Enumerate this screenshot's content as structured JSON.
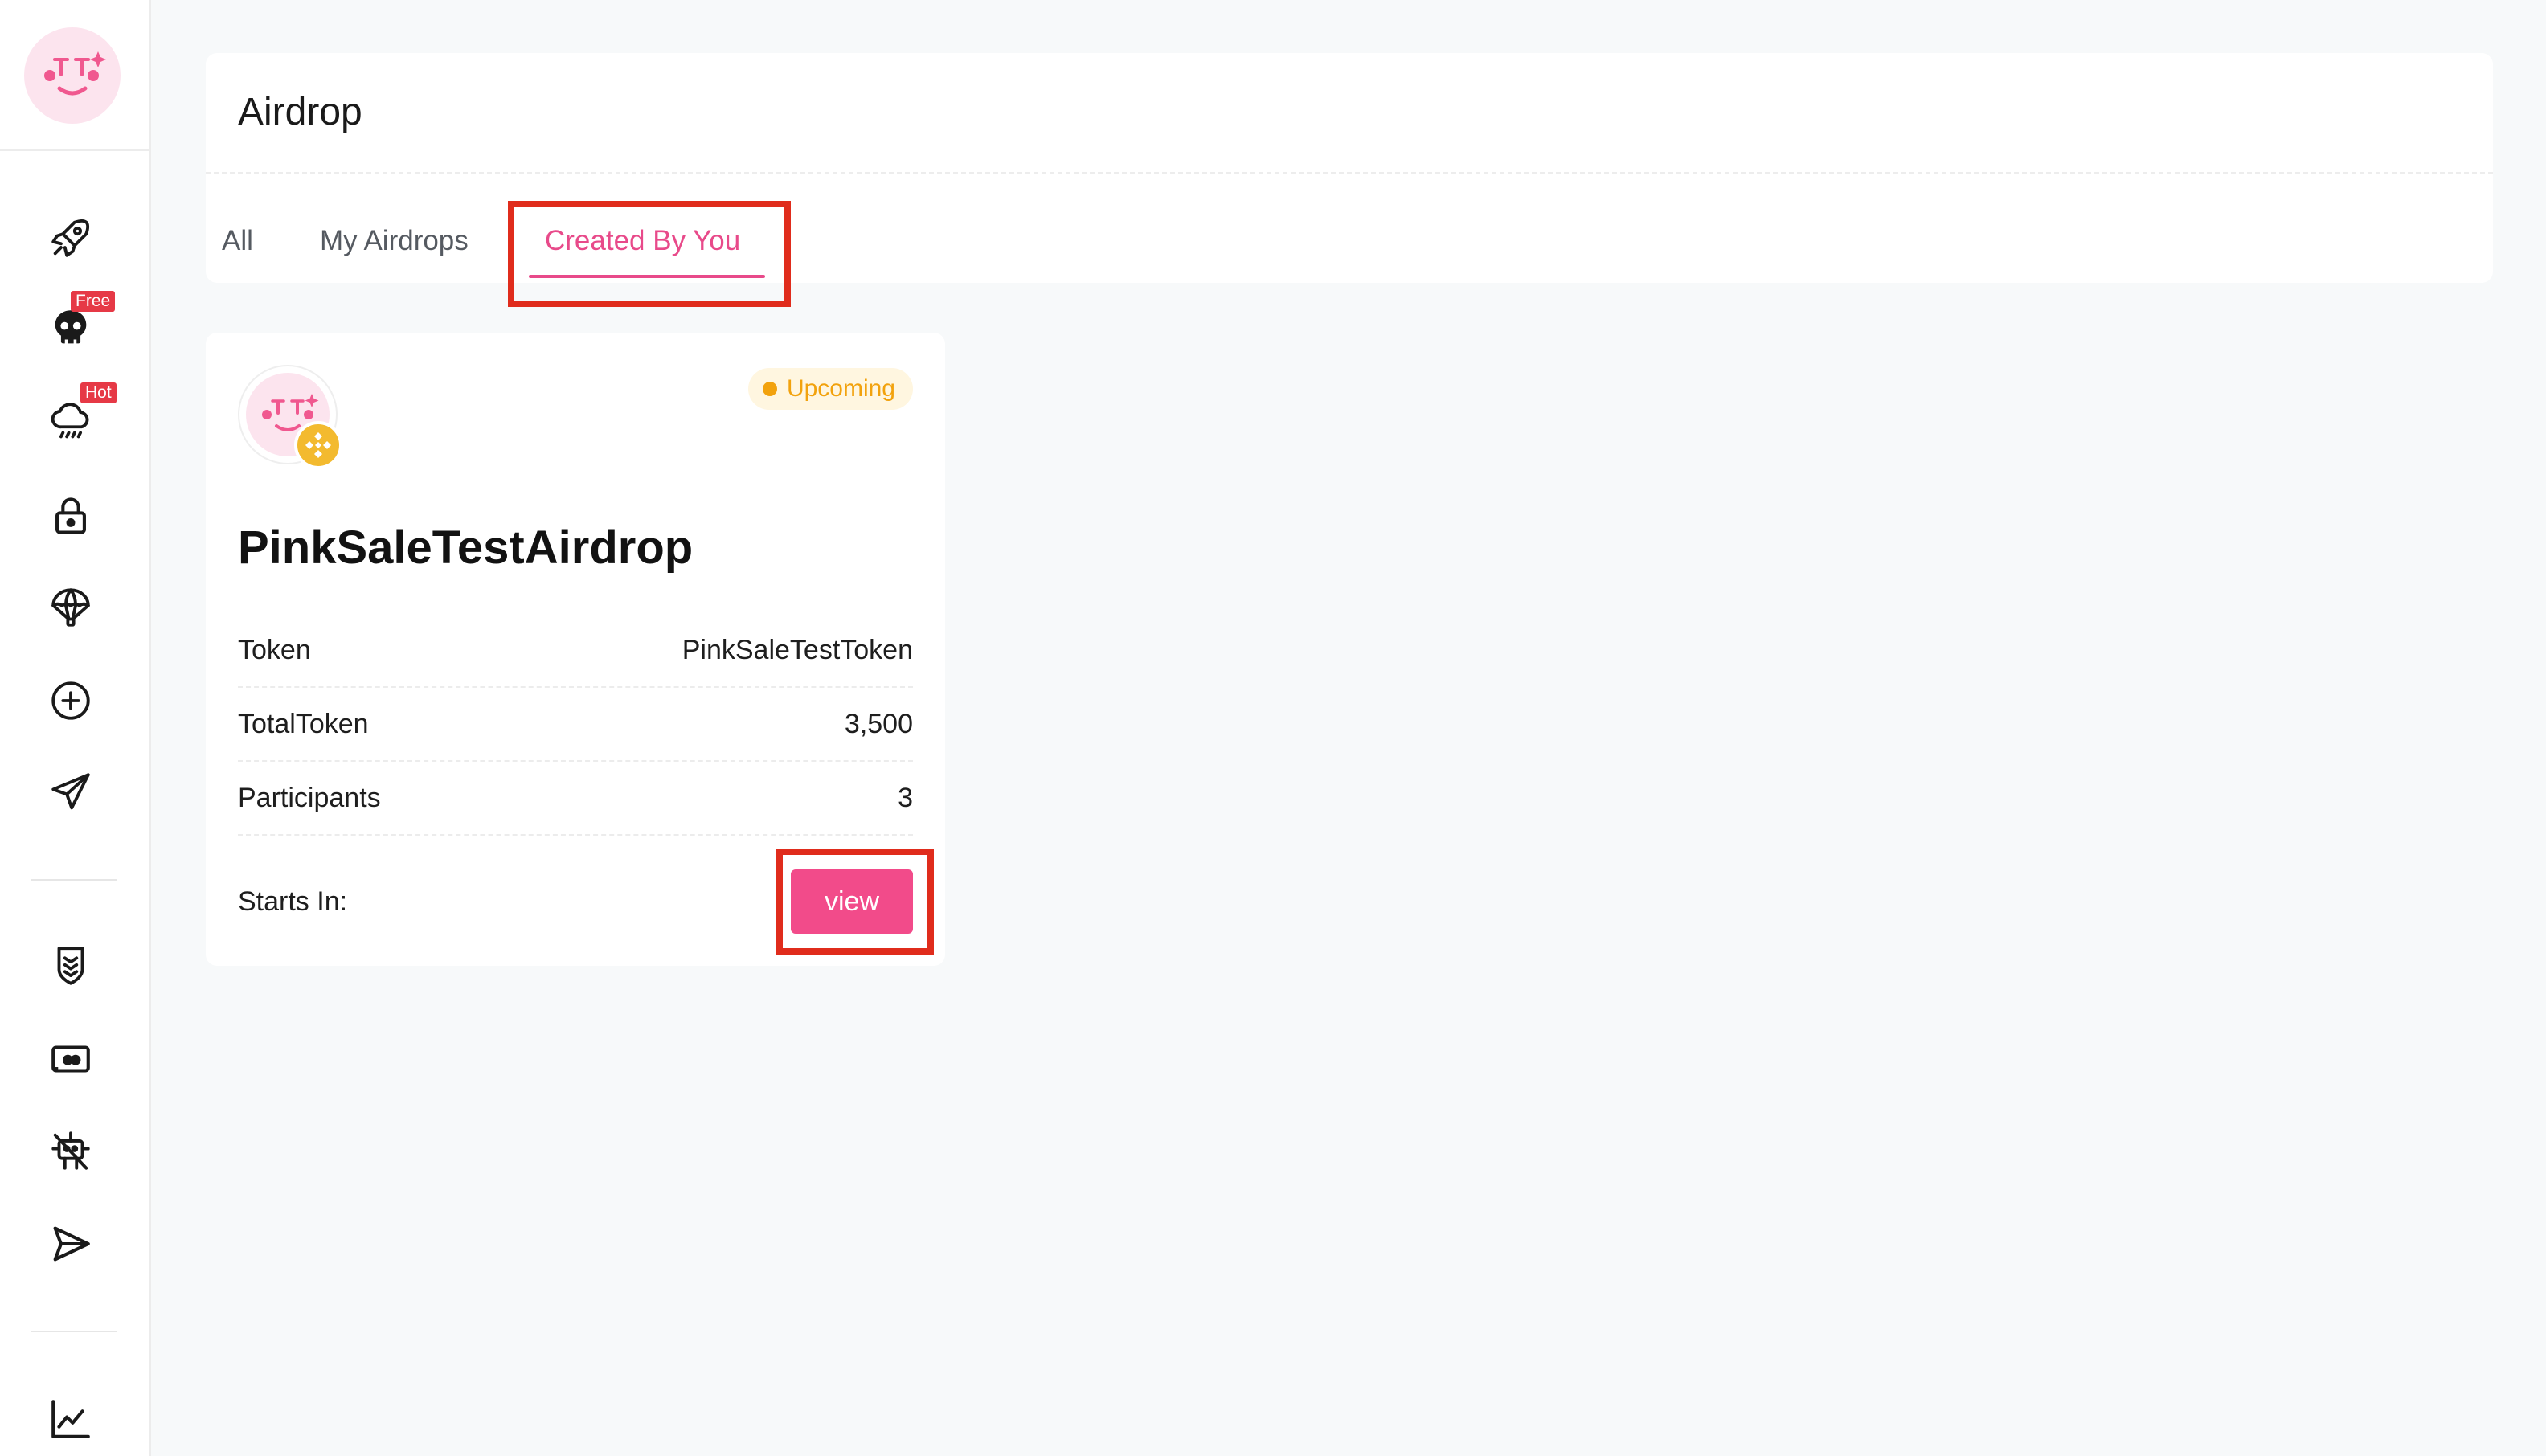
{
  "app": {
    "logo_icon": "pinksale-smiley-logo",
    "brand_color": "#e84a8a"
  },
  "sidebar": {
    "items": [
      {
        "icon": "rocket-icon"
      },
      {
        "icon": "skull-icon",
        "badge": "Free"
      },
      {
        "icon": "rain-cloud-icon",
        "badge": "Hot"
      },
      {
        "icon": "lock-icon"
      },
      {
        "icon": "parachute-icon"
      },
      {
        "icon": "plus-circle-icon"
      },
      {
        "icon": "paper-plane-icon"
      },
      {
        "icon": "shield-icon"
      },
      {
        "icon": "ticket-icon"
      },
      {
        "icon": "bot-off-icon"
      },
      {
        "icon": "send-icon"
      },
      {
        "icon": "chart-line-icon"
      }
    ]
  },
  "header": {
    "title": "Airdrop",
    "tabs": [
      {
        "label": "All",
        "active": false
      },
      {
        "label": "My Airdrops",
        "active": false
      },
      {
        "label": "Created By You",
        "active": true
      }
    ]
  },
  "airdrop_card": {
    "status": "Upcoming",
    "status_color": "#f2a20d",
    "chain_icon": "bnb-chain-icon",
    "name": "PinkSaleTestAirdrop",
    "rows": [
      {
        "label": "Token",
        "value": "PinkSaleTestToken"
      },
      {
        "label": "TotalToken",
        "value": "3,500"
      },
      {
        "label": "Participants",
        "value": "3"
      }
    ],
    "starts_in_label": "Starts In:",
    "view_label": "view",
    "button_color": "#f24b8a"
  },
  "annotations": {
    "highlight_color": "#e02c1c"
  }
}
